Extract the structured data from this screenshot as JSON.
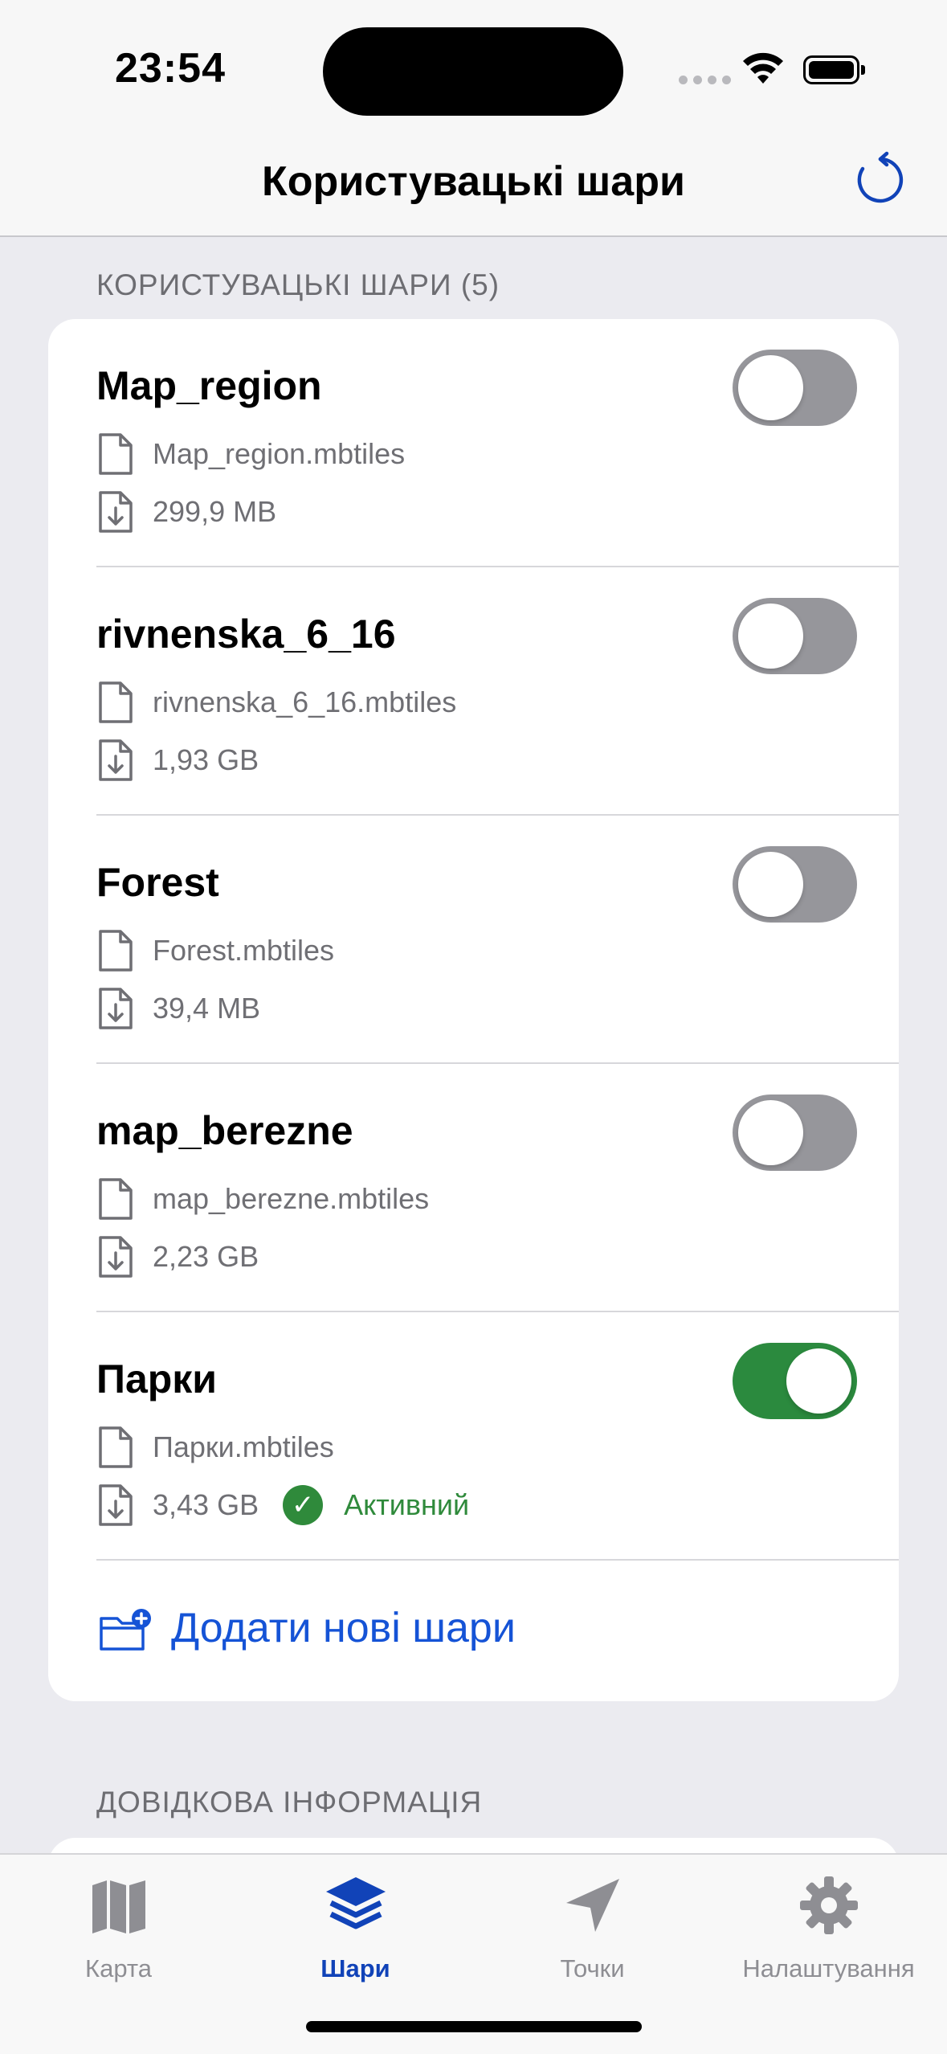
{
  "status_bar": {
    "time": "23:54"
  },
  "nav": {
    "title": "Користувацькі шари",
    "refresh_icon": "refresh-icon"
  },
  "sections": {
    "layers_header": "КОРИСТУВАЦЬКІ ШАРИ (5)",
    "info_header": "ДОВІДКОВА ІНФОРМАЦІЯ"
  },
  "layers": [
    {
      "name": "Map_region",
      "file": "Map_region.mbtiles",
      "size": "299,9 MB",
      "enabled": false
    },
    {
      "name": "rivnenska_6_16",
      "file": "rivnenska_6_16.mbtiles",
      "size": "1,93 GB",
      "enabled": false
    },
    {
      "name": "Forest",
      "file": "Forest.mbtiles",
      "size": "39,4 MB",
      "enabled": false
    },
    {
      "name": "map_berezne",
      "file": "map_berezne.mbtiles",
      "size": "2,23 GB",
      "enabled": false
    },
    {
      "name": "Парки",
      "file": "Парки.mbtiles",
      "size": "3,43 GB",
      "enabled": true,
      "status": "Активний"
    }
  ],
  "add_layers": {
    "label": "Додати нові шари"
  },
  "tabbar": {
    "tabs": [
      {
        "label": "Карта",
        "icon": "map-icon",
        "active": false
      },
      {
        "label": "Шари",
        "icon": "layers-icon",
        "active": true
      },
      {
        "label": "Точки",
        "icon": "location-arrow-icon",
        "active": false
      },
      {
        "label": "Налаштування",
        "icon": "gear-icon",
        "active": false
      }
    ]
  },
  "colors": {
    "accent": "#1553d6",
    "tab_active": "#1143b8",
    "toggle_on": "#2b8a3e",
    "toggle_off": "#96969b",
    "active_status": "#2f8a3b"
  }
}
